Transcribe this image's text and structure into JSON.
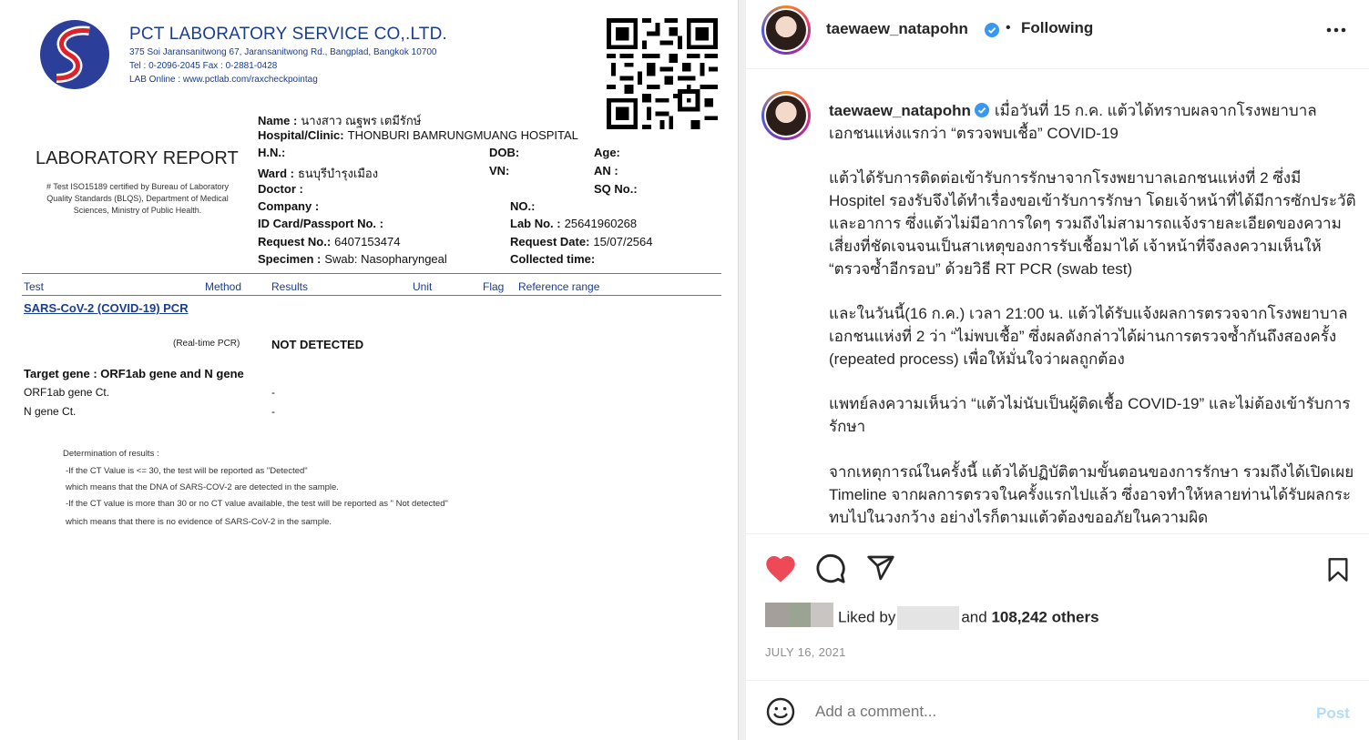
{
  "report": {
    "company_name": "PCT LABORATORY SERVICE CO,.LTD.",
    "address": "375 Soi Jaransanitwong 67, Jaransanitwong Rd., Bangplad, Bangkok 10700",
    "phone": "Tel : 0-2096-2045    Fax : 0-2881-0428",
    "lab_online": "LAB Online : www.pctlab.com/raxcheckpointag",
    "title": "LABORATORY REPORT",
    "iso_note": "# Test ISO15189 certified by Bureau of Laboratory Quality Standards (BLQS), Department of Medical Sciences, Ministry of Public Health.",
    "fields": {
      "name_label": "Name :",
      "name_value": "นางสาว ณฐพร เตมีรักษ์",
      "hospital_label": "Hospital/Clinic:",
      "hospital_value": "THONBURI BAMRUNGMUANG HOSPITAL",
      "hn_label": "H.N.:",
      "dob_label": "DOB:",
      "age_label": "Age:",
      "ward_label": "Ward :",
      "ward_value": "ธนบุรีบำรุงเมือง",
      "vn_label": "VN:",
      "an_label": "AN :",
      "doctor_label": "Doctor :",
      "sq_label": "SQ No.:",
      "company_label": "Company :",
      "no_label": "NO.:",
      "id_label": "ID Card/Passport No. :",
      "lab_no_label": "Lab No. :",
      "lab_no_value": "25641960268",
      "request_no_label": "Request No.:",
      "request_no_value": "6407153474",
      "request_date_label": "Request Date:",
      "request_date_value": "15/07/2564",
      "specimen_label": "Specimen :",
      "specimen_value": "Swab: Nasopharyngeal",
      "collected_label": "Collected time:"
    },
    "table_headers": [
      "Test",
      "Method",
      "Results",
      "Unit",
      "Flag",
      "Reference range"
    ],
    "test_name": "SARS-CoV-2 (COVID-19) PCR",
    "method": "(Real-time PCR)",
    "result": "NOT DETECTED",
    "target_gene": "Target gene : ORF1ab gene and N gene",
    "genes": [
      {
        "name": "ORF1ab gene Ct.",
        "value": "-"
      },
      {
        "name": "N gene Ct.",
        "value": "-"
      }
    ],
    "determination": [
      "Determination of results :",
      "-If the CT Value is <= 30, the test will be reported as \"Detected\"",
      "which means that the DNA of SARS-COV-2 are detected in the sample.",
      "-If the CT value is more than 30 or no CT value available, the test will be reported as \" Not detected\"",
      "which means that there is no evidence of SARS-CoV-2 in the sample."
    ]
  },
  "post": {
    "username": "taewaew_natapohn",
    "follow_status": "Following",
    "caption_first": "เมื่อวันที่ 15 ก.ค. แต้วได้ทราบผลจากโรงพยาบาลเอกชนแห่งแรกว่า “ตรวจพบเชื้อ” COVID-19",
    "caption_paragraphs": [
      "แต้วได้รับการติดต่อเข้ารับการรักษาจากโรงพยาบาลเอกชนแห่งที่ 2 ซึ่งมี Hospitel รองรับจึงได้ทำเรื่องขอเข้ารับการรักษา โดยเจ้าหน้าที่ได้มีการซักประวัติและอาการ ซึ่งแต้วไม่มีอาการใดๆ รวมถึงไม่สามารถแจ้งรายละเอียดของความเสี่ยงที่ชัดเจนจนเป็นสาเหตุของการรับเชื้อมาได้ เจ้าหน้าที่จึงลงความเห็นให้ “ตรวจซ้ำอีกรอบ” ด้วยวิธี RT PCR (swab test)",
      "และในวันนี้(16 ก.ค.) เวลา 21:00 น. แต้วได้รับแจ้งผลการตรวจจากโรงพยาบาลเอกชนแห่งที่ 2 ว่า “ไม่พบเชื้อ” ซึ่งผลดังกล่าวได้ผ่านการตรวจซ้ำกันถึงสองครั้ง (repeated process) เพื่อให้มั่นใจว่าผลถูกต้อง",
      "แพทย์ลงความเห็นว่า “แต้วไม่นับเป็นผู้ติดเชื้อ COVID-19” และไม่ต้องเข้ารับการรักษา",
      "จากเหตุการณ์ในครั้งนี้ แต้วได้ปฏิบัติตามขั้นตอนของการรักษา รวมถึงได้เปิดเผย Timeline จากผลการตรวจในครั้งแรกไปแล้ว ซึ่งอาจทำให้หลายท่านได้รับผลกระทบไปในวงกว้าง อย่างไรก็ตามแต้วต้องขออภัยในความผิด"
    ],
    "liked_by_prefix": "Liked by",
    "liked_and": "and",
    "liked_count": "108,242 others",
    "date": "JULY 16, 2021",
    "comment_placeholder": "Add a comment...",
    "post_label": "Post"
  },
  "colors": {
    "brand_blue": "#1a3d8f",
    "like_red": "#ed4956",
    "post_disabled": "#b3dbff",
    "verified_blue": "#3897f0"
  },
  "icons": [
    "heart-icon",
    "comment-icon",
    "share-icon",
    "bookmark-icon",
    "more-icon",
    "emoji-icon",
    "verified-icon",
    "qr-code",
    "pct-logo"
  ]
}
